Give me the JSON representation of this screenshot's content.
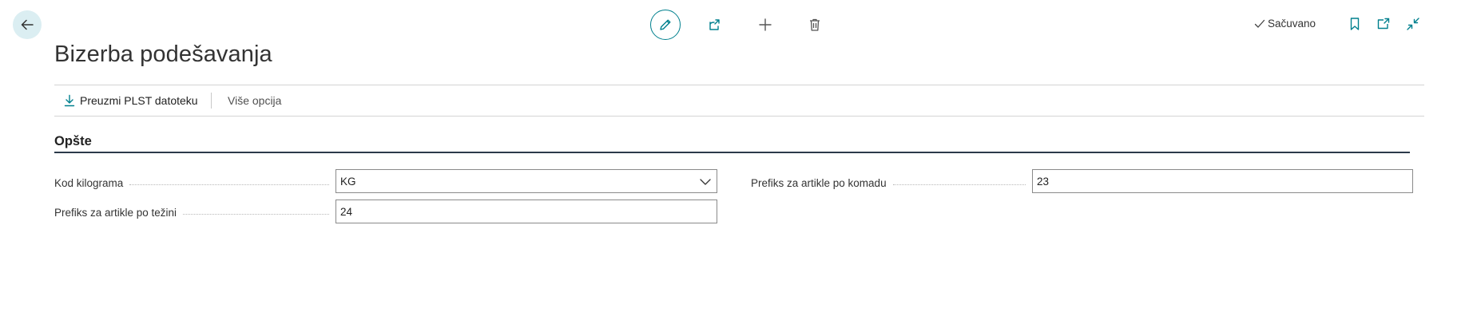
{
  "header": {
    "status": "Sačuvano"
  },
  "page": {
    "title": "Bizerba podešavanja"
  },
  "actions": {
    "download_label": "Preuzmi PLST datoteku",
    "more_label": "Više opcija"
  },
  "section": {
    "title": "Opšte",
    "fields": {
      "kilogram_code": {
        "label": "Kod kilograma",
        "value": "KG"
      },
      "piece_prefix": {
        "label": "Prefiks za artikle po komadu",
        "value": "23"
      },
      "weight_prefix": {
        "label": "Prefiks za artikle po težini",
        "value": "24"
      }
    }
  },
  "icons": {
    "back": "arrow-left-icon",
    "edit": "pencil-icon",
    "share": "share-icon",
    "add": "plus-icon",
    "delete": "trash-icon",
    "saved": "checkmark-icon",
    "bookmark": "bookmark-icon",
    "popout": "open-new-window-icon",
    "collapse": "collapse-icon",
    "download": "download-icon",
    "dropdown": "chevron-down-icon"
  },
  "colors": {
    "accent": "#00808e",
    "back_bg": "#dbeef2",
    "section_rule": "#2b3a4a"
  }
}
